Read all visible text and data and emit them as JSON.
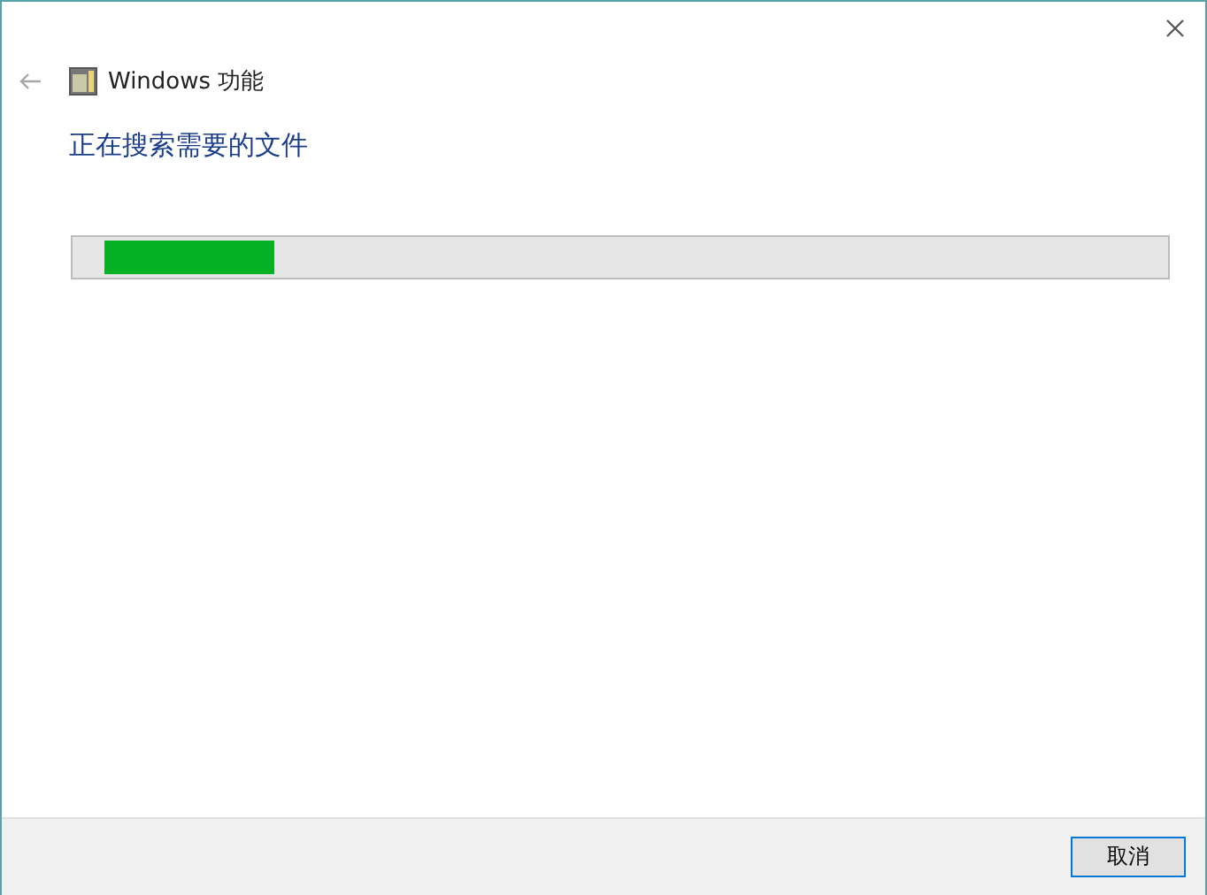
{
  "window": {
    "title": "Windows 功能"
  },
  "heading": "正在搜索需要的文件",
  "progress": {
    "level": 0.16
  },
  "buttons": [
    "取消"
  ]
}
